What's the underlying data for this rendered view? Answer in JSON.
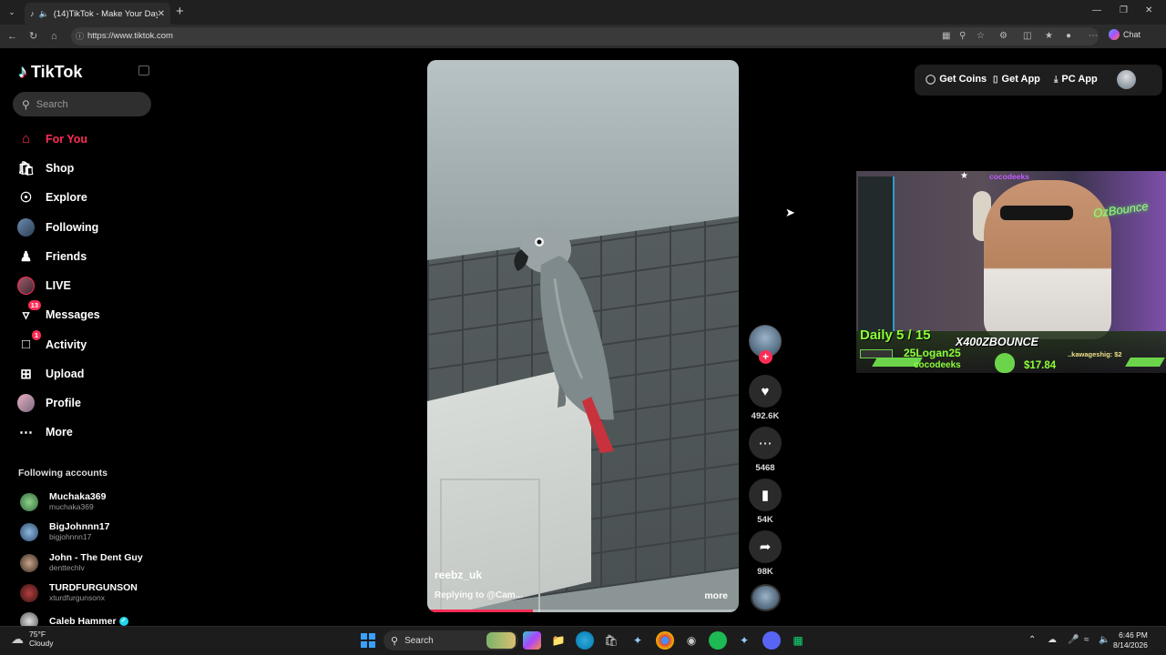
{
  "browser": {
    "tab_title": "(14)TikTok - Make Your Day",
    "url": "https://www.tiktok.com",
    "chat_label": "Chat"
  },
  "sidebar": {
    "brand": "TikTok",
    "search_placeholder": "Search",
    "items": [
      {
        "label": "For You",
        "icon": "home-icon",
        "active": true
      },
      {
        "label": "Shop",
        "icon": "shopping-bag-icon"
      },
      {
        "label": "Explore",
        "icon": "compass-icon"
      },
      {
        "label": "Following",
        "icon": "avatar-icon"
      },
      {
        "label": "Friends",
        "icon": "friends-icon"
      },
      {
        "label": "LIVE",
        "icon": "live-icon"
      },
      {
        "label": "Messages",
        "icon": "messages-icon",
        "badge": "13"
      },
      {
        "label": "Activity",
        "icon": "activity-icon",
        "badge": "1"
      },
      {
        "label": "Upload",
        "icon": "upload-icon"
      },
      {
        "label": "Profile",
        "icon": "profile-avatar-icon"
      },
      {
        "label": "More",
        "icon": "more-dots-icon"
      }
    ],
    "following_header": "Following accounts",
    "accounts": [
      {
        "name": "Muchaka369",
        "username": "muchaka369"
      },
      {
        "name": "BigJohnnn17",
        "username": "bigjohnnn17"
      },
      {
        "name": "John - The Dent Guy",
        "username": "denttechlv"
      },
      {
        "name": "TURDFURGUNSON",
        "username": "xturdfurgunsonx"
      },
      {
        "name": "Caleb Hammer",
        "username": "",
        "verified": true
      }
    ]
  },
  "video": {
    "author": "reebz_uk",
    "caption": "Replying to @Cam...",
    "more_label": "more",
    "progress": 0.34
  },
  "actions": {
    "likes": "492.6K",
    "comments": "5468",
    "saves": "54K",
    "shares": "98K"
  },
  "top_right": {
    "get_coins": "Get Coins",
    "get_app": "Get App",
    "pc_app": "PC App"
  },
  "stream_overlay": {
    "top_name": "cocodeeks",
    "daily": "Daily 5 / 15",
    "handle": "X400ZBOUNCE",
    "top_donor": "25Logan25",
    "donor2": "cocodeeks",
    "ticker": "..kawageshig: $2",
    "amount": "$17.84",
    "neon_sign": "OzBounce"
  },
  "taskbar": {
    "temp": "75°F",
    "weather": "Cloudy",
    "search": "Search",
    "time": "6:46 PM",
    "date": "8/14/2026"
  }
}
